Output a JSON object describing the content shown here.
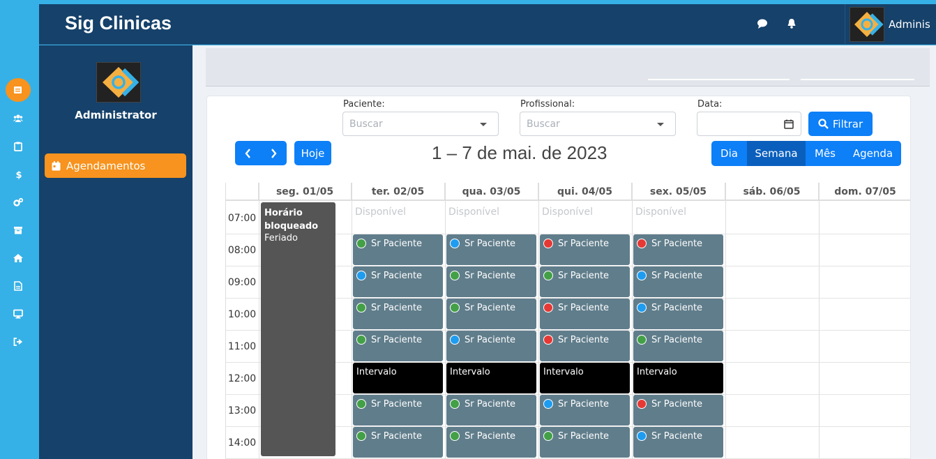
{
  "app": {
    "title": "Sig Clinicas",
    "user": "Adminis"
  },
  "sidebar": {
    "profile_name": "Administrator",
    "active_item": "Agendamentos"
  },
  "rail_icons": [
    "calendar-icon",
    "users-icon",
    "clipboard-icon",
    "dollar-icon",
    "gears-icon",
    "archive-icon",
    "home-icon",
    "document-icon",
    "monitor-icon",
    "logout-icon"
  ],
  "filters": {
    "paciente_label": "Paciente:",
    "paciente_placeholder": "Buscar",
    "profissional_label": "Profissional:",
    "profissional_placeholder": "Buscar",
    "data_label": "Data:",
    "filter_button": "Filtrar"
  },
  "calendar": {
    "today_button": "Hoje",
    "range_title": "1 – 7 de mai. de 2023",
    "views": [
      "Dia",
      "Semana",
      "Mês",
      "Agenda"
    ],
    "active_view": "Semana",
    "days": [
      "seg. 01/05",
      "ter. 02/05",
      "qua. 03/05",
      "qui. 04/05",
      "sex. 05/05",
      "sáb. 06/05",
      "dom. 07/05"
    ],
    "hours": [
      "07:00",
      "08:00",
      "09:00",
      "10:00",
      "11:00",
      "12:00",
      "13:00",
      "14:00"
    ],
    "available_label": "Disponível",
    "blocked": {
      "title": "Horário bloqueado",
      "reason": "Feriado"
    },
    "break_label": "Intervalo",
    "patient_label": "Sr Paciente",
    "status_colors": {
      "green": "#43a047",
      "blue": "#1e9cf0",
      "red": "#e53935"
    },
    "appointments": [
      [
        "green",
        "blue",
        "red",
        "red"
      ],
      [
        "blue",
        "green",
        "green",
        "blue"
      ],
      [
        "green",
        "green",
        "red",
        "blue"
      ],
      [
        "green",
        "blue",
        "red",
        "green"
      ],
      [
        "break",
        "break",
        "break",
        "break"
      ],
      [
        "green",
        "green",
        "blue",
        "red"
      ],
      [
        "green",
        "green",
        "green",
        "blue"
      ]
    ]
  }
}
